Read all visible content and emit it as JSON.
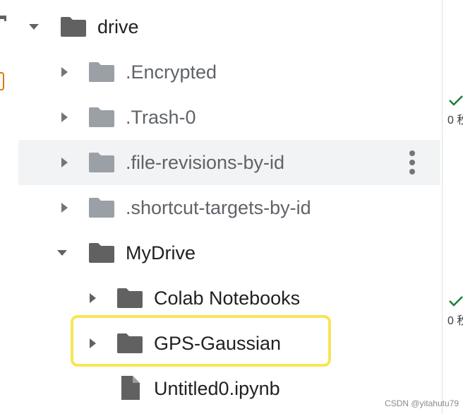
{
  "file_tree": {
    "items": [
      {
        "label": "drive",
        "kind": "folder",
        "expanded": true,
        "muted": false
      },
      {
        "label": ".Encrypted",
        "kind": "folder",
        "expanded": false,
        "muted": true
      },
      {
        "label": ".Trash-0",
        "kind": "folder",
        "expanded": false,
        "muted": true
      },
      {
        "label": ".file-revisions-by-id",
        "kind": "folder",
        "expanded": false,
        "muted": true
      },
      {
        "label": ".shortcut-targets-by-id",
        "kind": "folder",
        "expanded": false,
        "muted": true
      },
      {
        "label": "MyDrive",
        "kind": "folder",
        "expanded": true,
        "muted": false
      },
      {
        "label": "Colab Notebooks",
        "kind": "folder",
        "expanded": false,
        "muted": false
      },
      {
        "label": "GPS-Gaussian",
        "kind": "folder",
        "expanded": false,
        "muted": false,
        "highlighted": true
      },
      {
        "label": "Untitled0.ipynb",
        "kind": "file",
        "muted": false
      }
    ],
    "hovered_item": ".file-revisions-by-id",
    "more_actions_icon": "more-vert-icon"
  },
  "right_panel": {
    "status_1": "0 秒",
    "status_2": "0 秒",
    "check_icon": "check-icon"
  },
  "watermark": "CSDN @yitahutu79",
  "colors": {
    "highlight_border": "#f8e555",
    "folder_dark": "#616161",
    "folder_light": "#9aa0a6",
    "check_green": "#188038",
    "accent_orange": "#e37400"
  }
}
